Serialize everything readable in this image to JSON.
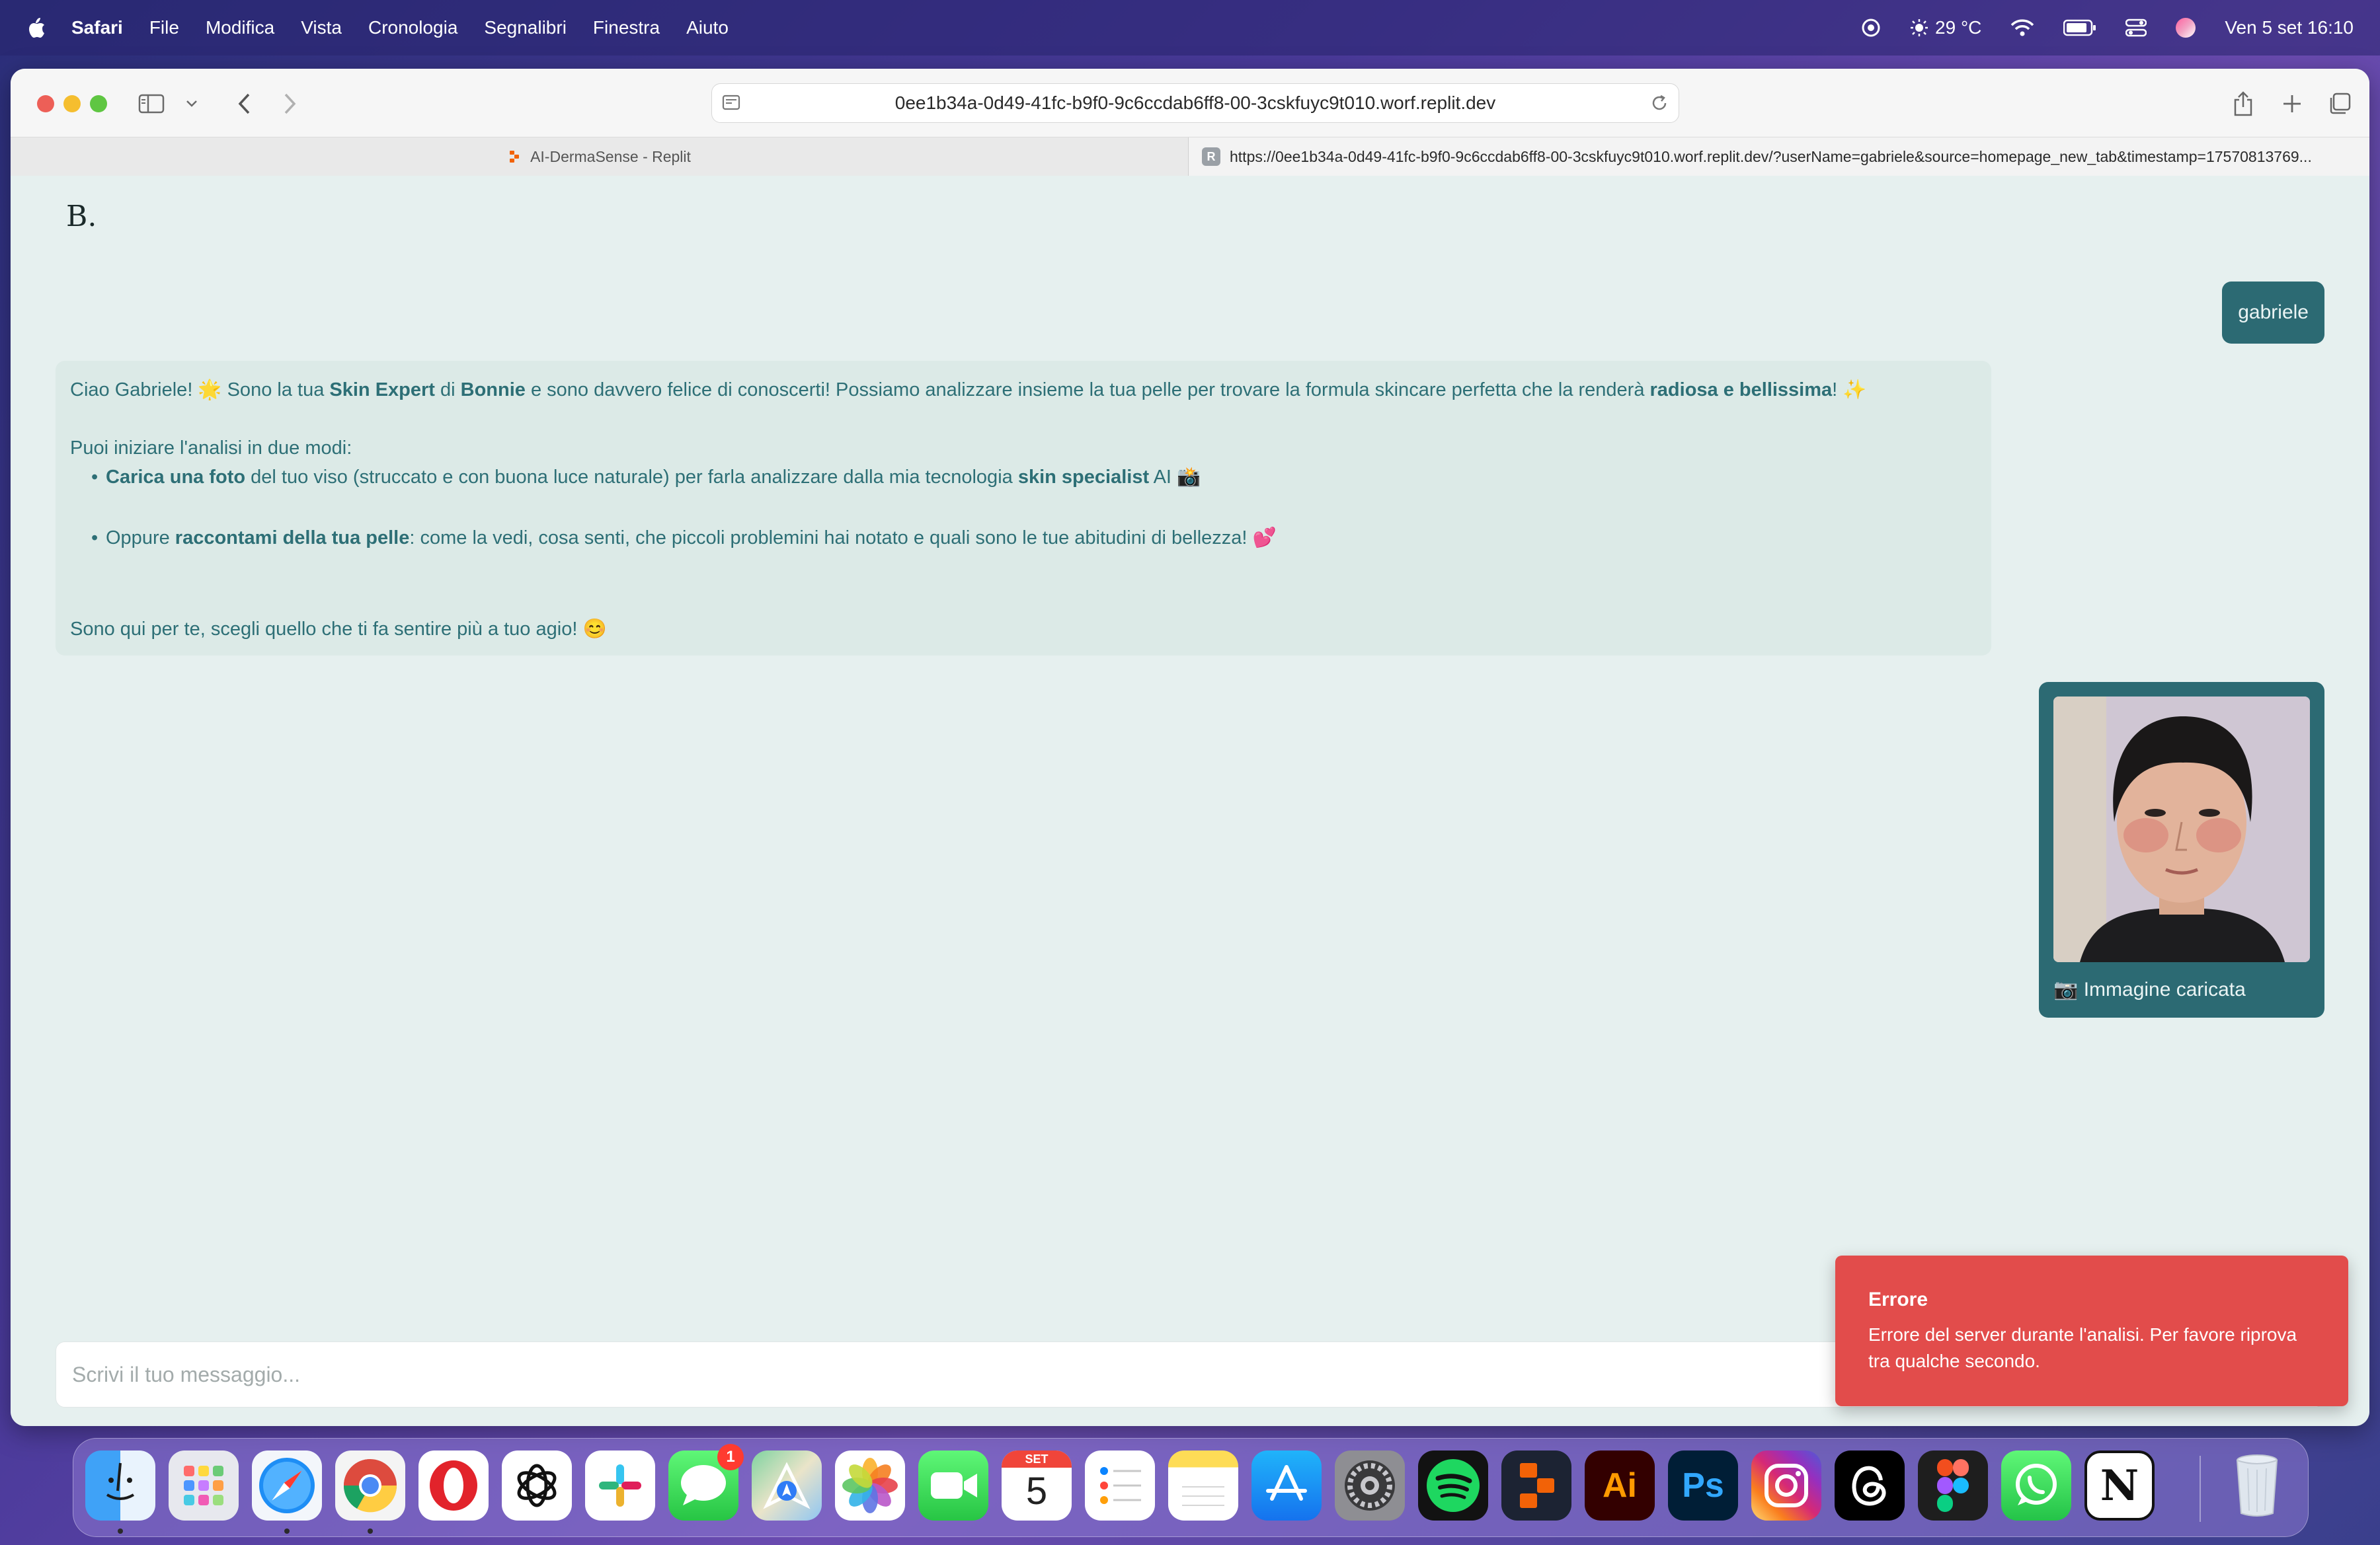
{
  "menubar": {
    "app": "Safari",
    "items": [
      "File",
      "Modifica",
      "Vista",
      "Cronologia",
      "Segnalibri",
      "Finestra",
      "Aiuto"
    ],
    "weather": "29 °C",
    "datetime": "Ven 5 set  16:10"
  },
  "browser": {
    "url": "0ee1b34a-0d49-41fc-b9f0-9c6ccdab6ff8-00-3cskfuyc9t010.worf.replit.dev",
    "tabs": [
      {
        "title": "AI-DermaSense - Replit"
      },
      {
        "favicon_letter": "R",
        "title": "https://0ee1b34a-0d49-41fc-b9f0-9c6ccdab6ff8-00-3cskfuyc9t010.worf.replit.dev/?userName=gabriele&source=homepage_new_tab&timestamp=17570813769..."
      }
    ]
  },
  "page": {
    "brand": "B.",
    "user_message": "gabriele",
    "bot": {
      "l1_a": "Ciao Gabriele! 🌟 Sono la tua ",
      "l1_b": "Skin Expert",
      "l1_c": " di ",
      "l1_d": "Bonnie",
      "l1_e": " e sono davvero felice di conoscerti! Possiamo analizzare insieme la tua pelle per trovare la formula skincare perfetta che la renderà ",
      "l1_f": "radiosa e bellissima",
      "l1_g": "! ✨",
      "l2": "Puoi iniziare l'analisi in due modi:",
      "b1_a": "Carica una foto",
      "b1_b": " del tuo viso (struccato e con buona luce naturale) per farla analizzare dalla mia tecnologia ",
      "b1_c": "skin specialist",
      "b1_d": " AI 📸",
      "b2_a": "Oppure ",
      "b2_b": "raccontami della tua pelle",
      "b2_c": ": come la vedi, cosa senti, che piccoli problemini hai notato e quali sono le tue abitudini di bellezza! 💕",
      "l_end": "Sono qui per te, scegli quello che ti fa sentire più a tuo agio! 😊"
    },
    "image_caption": "📷 Immagine caricata",
    "input_placeholder": "Scrivi il tuo messaggio..."
  },
  "toast": {
    "title": "Errore",
    "description": "Errore del server durante l'analisi. Per favore riprova tra qualche secondo."
  },
  "dock": {
    "apps": [
      "finder",
      "launchpad",
      "safari",
      "chrome",
      "opera",
      "chatgpt",
      "slack",
      "messages",
      "maps",
      "photos",
      "facetime",
      "calendar",
      "reminders",
      "notes",
      "app-store",
      "system-settings",
      "spotify",
      "replit",
      "illustrator",
      "photoshop",
      "instagram",
      "threads",
      "figma",
      "whatsapp",
      "notion",
      "trash"
    ],
    "messages_badge": "1",
    "calendar_month": "SET",
    "calendar_day": "5",
    "illustrator_label": "Ai",
    "photoshop_label": "Ps",
    "notion_label": "N"
  }
}
